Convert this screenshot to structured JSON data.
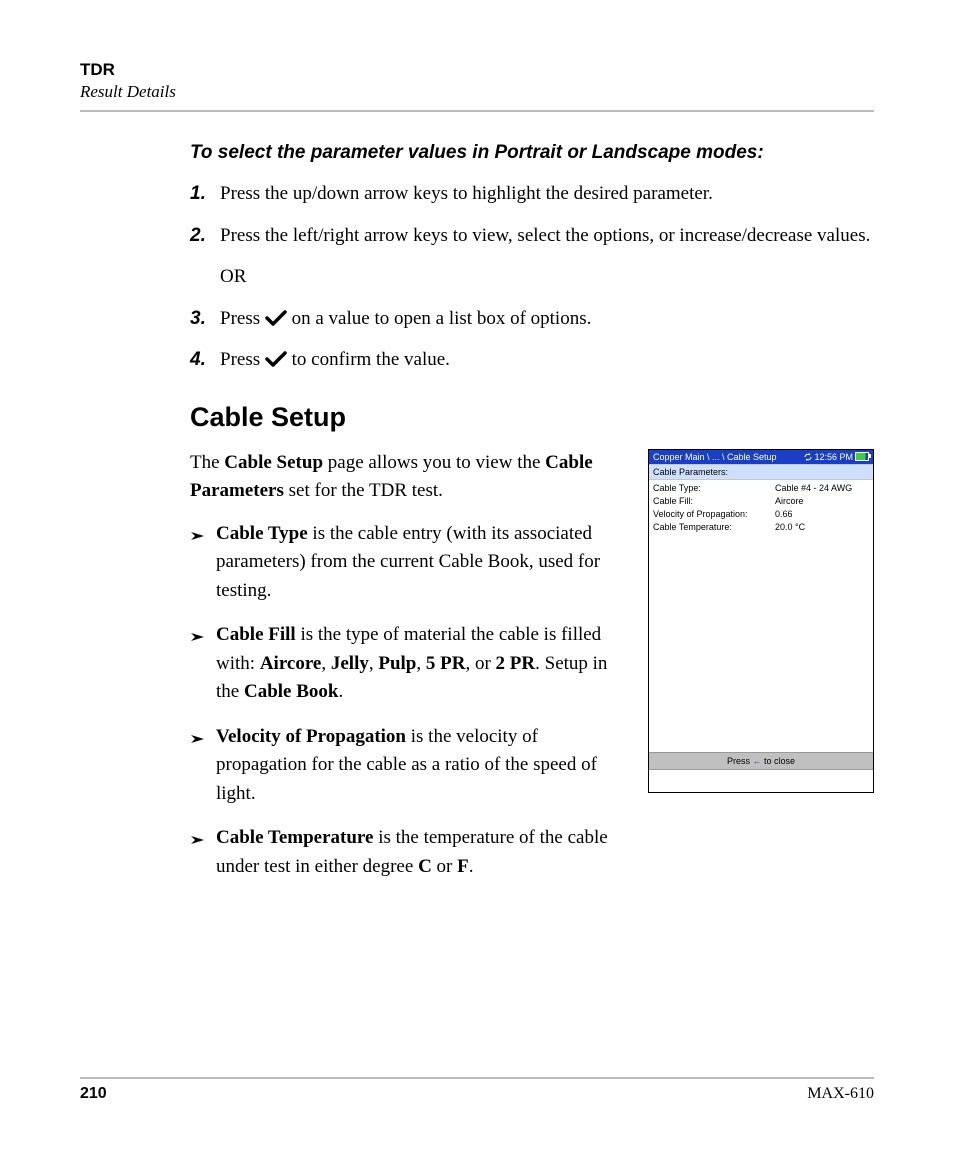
{
  "header": {
    "title": "TDR",
    "subtitle": "Result Details"
  },
  "instructions": {
    "lead": "To select the parameter values in Portrait or Landscape modes:",
    "steps": [
      {
        "num": "1.",
        "text": "Press the up/down arrow keys to highlight the desired parameter."
      },
      {
        "num": "2.",
        "text": "Press the left/right arrow keys to view, select the options, or increase/decrease values.",
        "or": "OR"
      },
      {
        "num": "3.",
        "before": "Press ",
        "after": " on a value to open a list box of options."
      },
      {
        "num": "4.",
        "before": "Press ",
        "after": " to confirm the value."
      }
    ]
  },
  "section": {
    "heading": "Cable Setup",
    "intro_a": "The ",
    "intro_b": "Cable Setup",
    "intro_c": " page allows you to view the ",
    "intro_d": "Cable Parameters",
    "intro_e": " set for the TDR test.",
    "bullets": [
      {
        "parts": [
          {
            "t": "Cable Type",
            "b": true
          },
          {
            "t": " is the cable entry (with its associated parameters) from the current Cable Book, used for testing."
          }
        ]
      },
      {
        "parts": [
          {
            "t": "Cable Fill",
            "b": true
          },
          {
            "t": " is the type of material the cable is filled with: "
          },
          {
            "t": "Aircore",
            "b": true
          },
          {
            "t": ", "
          },
          {
            "t": "Jelly",
            "b": true
          },
          {
            "t": ", "
          },
          {
            "t": "Pulp",
            "b": true
          },
          {
            "t": ", "
          },
          {
            "t": "5 PR",
            "b": true
          },
          {
            "t": ", or "
          },
          {
            "t": "2 PR",
            "b": true
          },
          {
            "t": ". Setup in the "
          },
          {
            "t": "Cable Book",
            "b": true
          },
          {
            "t": "."
          }
        ]
      },
      {
        "parts": [
          {
            "t": "Velocity of Propagation",
            "b": true
          },
          {
            "t": " is the velocity of propagation for the cable as a ratio of the speed of light."
          }
        ]
      },
      {
        "parts": [
          {
            "t": "Cable Temperature",
            "b": true
          },
          {
            "t": " is the temperature of the cable under test in either degree "
          },
          {
            "t": "C",
            "b": true
          },
          {
            "t": " or "
          },
          {
            "t": "F",
            "b": true
          },
          {
            "t": "."
          }
        ]
      }
    ]
  },
  "device": {
    "breadcrumb": "Copper Main \\ ... \\ Cable Setup",
    "time": "12:56 PM",
    "section_label": "Cable Parameters:",
    "rows": [
      {
        "label": "Cable Type:",
        "value": "Cable #4 - 24 AWG"
      },
      {
        "label": "Cable Fill:",
        "value": "Aircore"
      },
      {
        "label": "Velocity of Propagation:",
        "value": "0.66"
      },
      {
        "label": "Cable Temperature:",
        "value": "20.0 °C"
      }
    ],
    "footer_a": "Press ",
    "footer_b": " to close"
  },
  "footer": {
    "page": "210",
    "model": "MAX-610"
  }
}
